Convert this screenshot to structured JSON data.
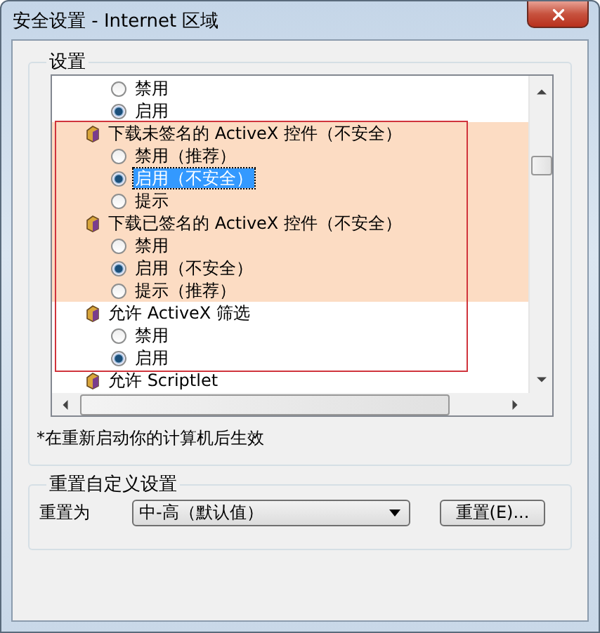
{
  "window": {
    "title": "安全设置 - Internet 区域"
  },
  "settings": {
    "legend": "设置",
    "annotation_frame": true,
    "items": [
      {
        "kind": "option",
        "text": "禁用",
        "checked": false,
        "selected": false,
        "highlighted": false
      },
      {
        "kind": "option",
        "text": "启用",
        "checked": true,
        "selected": false,
        "highlighted": false
      },
      {
        "kind": "header",
        "text": "下载未签名的 ActiveX 控件（不安全）",
        "selected": false,
        "highlighted": true
      },
      {
        "kind": "option",
        "text": "禁用（推荐）",
        "checked": false,
        "selected": false,
        "highlighted": true
      },
      {
        "kind": "option",
        "text": "启用（不安全）",
        "checked": true,
        "selected": true,
        "highlighted": true
      },
      {
        "kind": "option",
        "text": "提示",
        "checked": false,
        "selected": false,
        "highlighted": true
      },
      {
        "kind": "header",
        "text": "下载已签名的 ActiveX 控件（不安全）",
        "selected": false,
        "highlighted": true
      },
      {
        "kind": "option",
        "text": "禁用",
        "checked": false,
        "selected": false,
        "highlighted": true
      },
      {
        "kind": "option",
        "text": "启用（不安全）",
        "checked": true,
        "selected": false,
        "highlighted": true
      },
      {
        "kind": "option",
        "text": "提示（推荐）",
        "checked": false,
        "selected": false,
        "highlighted": true
      },
      {
        "kind": "header",
        "text": "允许 ActiveX 筛选",
        "selected": false,
        "highlighted": false
      },
      {
        "kind": "option",
        "text": "禁用",
        "checked": false,
        "selected": false,
        "highlighted": false
      },
      {
        "kind": "option",
        "text": "启用",
        "checked": true,
        "selected": false,
        "highlighted": false
      },
      {
        "kind": "header",
        "text": "允许 Scriptlet",
        "selected": false,
        "highlighted": false
      }
    ],
    "note": "*在重新启动你的计算机后生效"
  },
  "reset": {
    "legend": "重置自定义设置",
    "label": "重置为",
    "dropdown": {
      "value": "中-高（默认值）"
    },
    "button": "重置(E)..."
  }
}
